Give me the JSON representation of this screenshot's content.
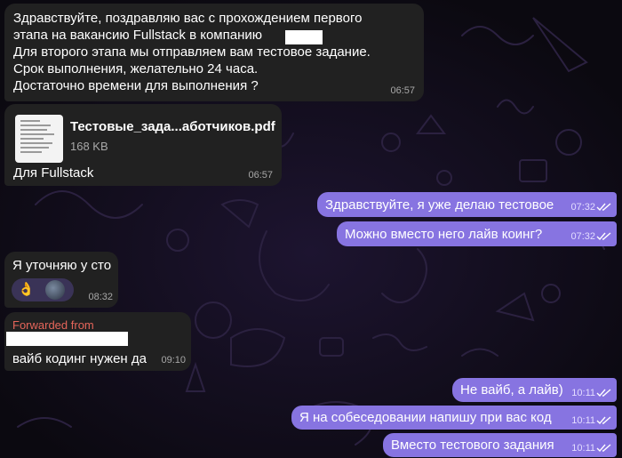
{
  "messages": {
    "m1": {
      "lines": [
        "Здравствуйте, поздравляю вас с прохождением первого",
        "этапа на вакансию Fullstack  в компанию",
        "Для второго этапа мы отправляем вам тестовое задание.",
        "Срок выполнения, желательно 24 часа.",
        "Достаточно времени для выполнения ?"
      ],
      "time": "06:57"
    },
    "m2": {
      "file_name": "Тестовые_зада...аботчиков.pdf",
      "file_size": "168 KB",
      "caption": "Для Fullstack",
      "time": "06:57"
    },
    "m3": {
      "text": "Здравствуйте, я уже делаю тестовое",
      "time": "07:32"
    },
    "m4": {
      "text": "Можно вместо него лайв коинг?",
      "time": "07:32"
    },
    "m5": {
      "text": "Я уточняю у сто",
      "reaction": "👌",
      "time": "08:32"
    },
    "m6": {
      "forwarded_label": "Forwarded from",
      "text": "вайб кодинг нужен да",
      "time": "09:10"
    },
    "m7": {
      "text": "Не вайб, а лайв)",
      "time": "10:11"
    },
    "m8": {
      "text": "Я на собеседовании напишу при вас код",
      "time": "10:11"
    },
    "m9": {
      "text": "Вместо тестового задания",
      "time": "10:11"
    }
  },
  "colors": {
    "background": "#0e0b14",
    "incoming_bubble": "#212121",
    "outgoing_bubble": "#8774e1",
    "forwarded_accent": "#e5655a"
  },
  "icons": [
    "pdf-thumbnail",
    "double-check-icon",
    "avatar"
  ]
}
